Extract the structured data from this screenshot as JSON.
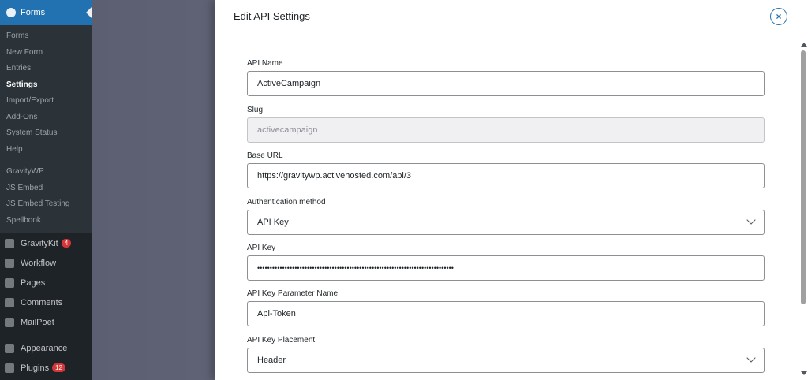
{
  "sidebar": {
    "forms_label": "Forms",
    "forms_submenu": [
      "Forms",
      "New Form",
      "Entries",
      "Settings",
      "Import/Export",
      "Add-Ons",
      "System Status",
      "Help"
    ],
    "current": "Settings",
    "addon_submenu": [
      "GravityWP",
      "JS Embed",
      "JS Embed Testing",
      "Spellbook"
    ],
    "menu": [
      {
        "label": "GravityKit",
        "icon": "gravitykit-icon",
        "badge": "4"
      },
      {
        "label": "Workflow",
        "icon": "workflow-icon",
        "badge": ""
      },
      {
        "label": "Pages",
        "icon": "pages-icon",
        "badge": ""
      },
      {
        "label": "Comments",
        "icon": "comments-icon",
        "badge": ""
      },
      {
        "label": "MailPoet",
        "icon": "mailpoet-icon",
        "badge": ""
      },
      {
        "label": "Appearance",
        "icon": "appearance-icon",
        "badge": ""
      },
      {
        "label": "Plugins",
        "icon": "plugins-icon",
        "badge": "12"
      }
    ]
  },
  "modal": {
    "title": "Edit API Settings",
    "close_icon": "×",
    "fields": {
      "api_name": {
        "label": "API Name",
        "value": "ActiveCampaign"
      },
      "slug": {
        "label": "Slug",
        "value": "activecampaign"
      },
      "base_url": {
        "label": "Base URL",
        "value": "https://gravitywp.activehosted.com/api/3"
      },
      "auth_method": {
        "label": "Authentication method",
        "value": "API Key"
      },
      "api_key": {
        "label": "API Key",
        "value": "•••••••••••••••••••••••••••••••••••••••••••••••••••••••••••••••••••••••••••••••"
      },
      "param_name": {
        "label": "API Key Parameter Name",
        "value": "Api-Token"
      },
      "placement": {
        "label": "API Key Placement",
        "value": "Header"
      }
    }
  }
}
